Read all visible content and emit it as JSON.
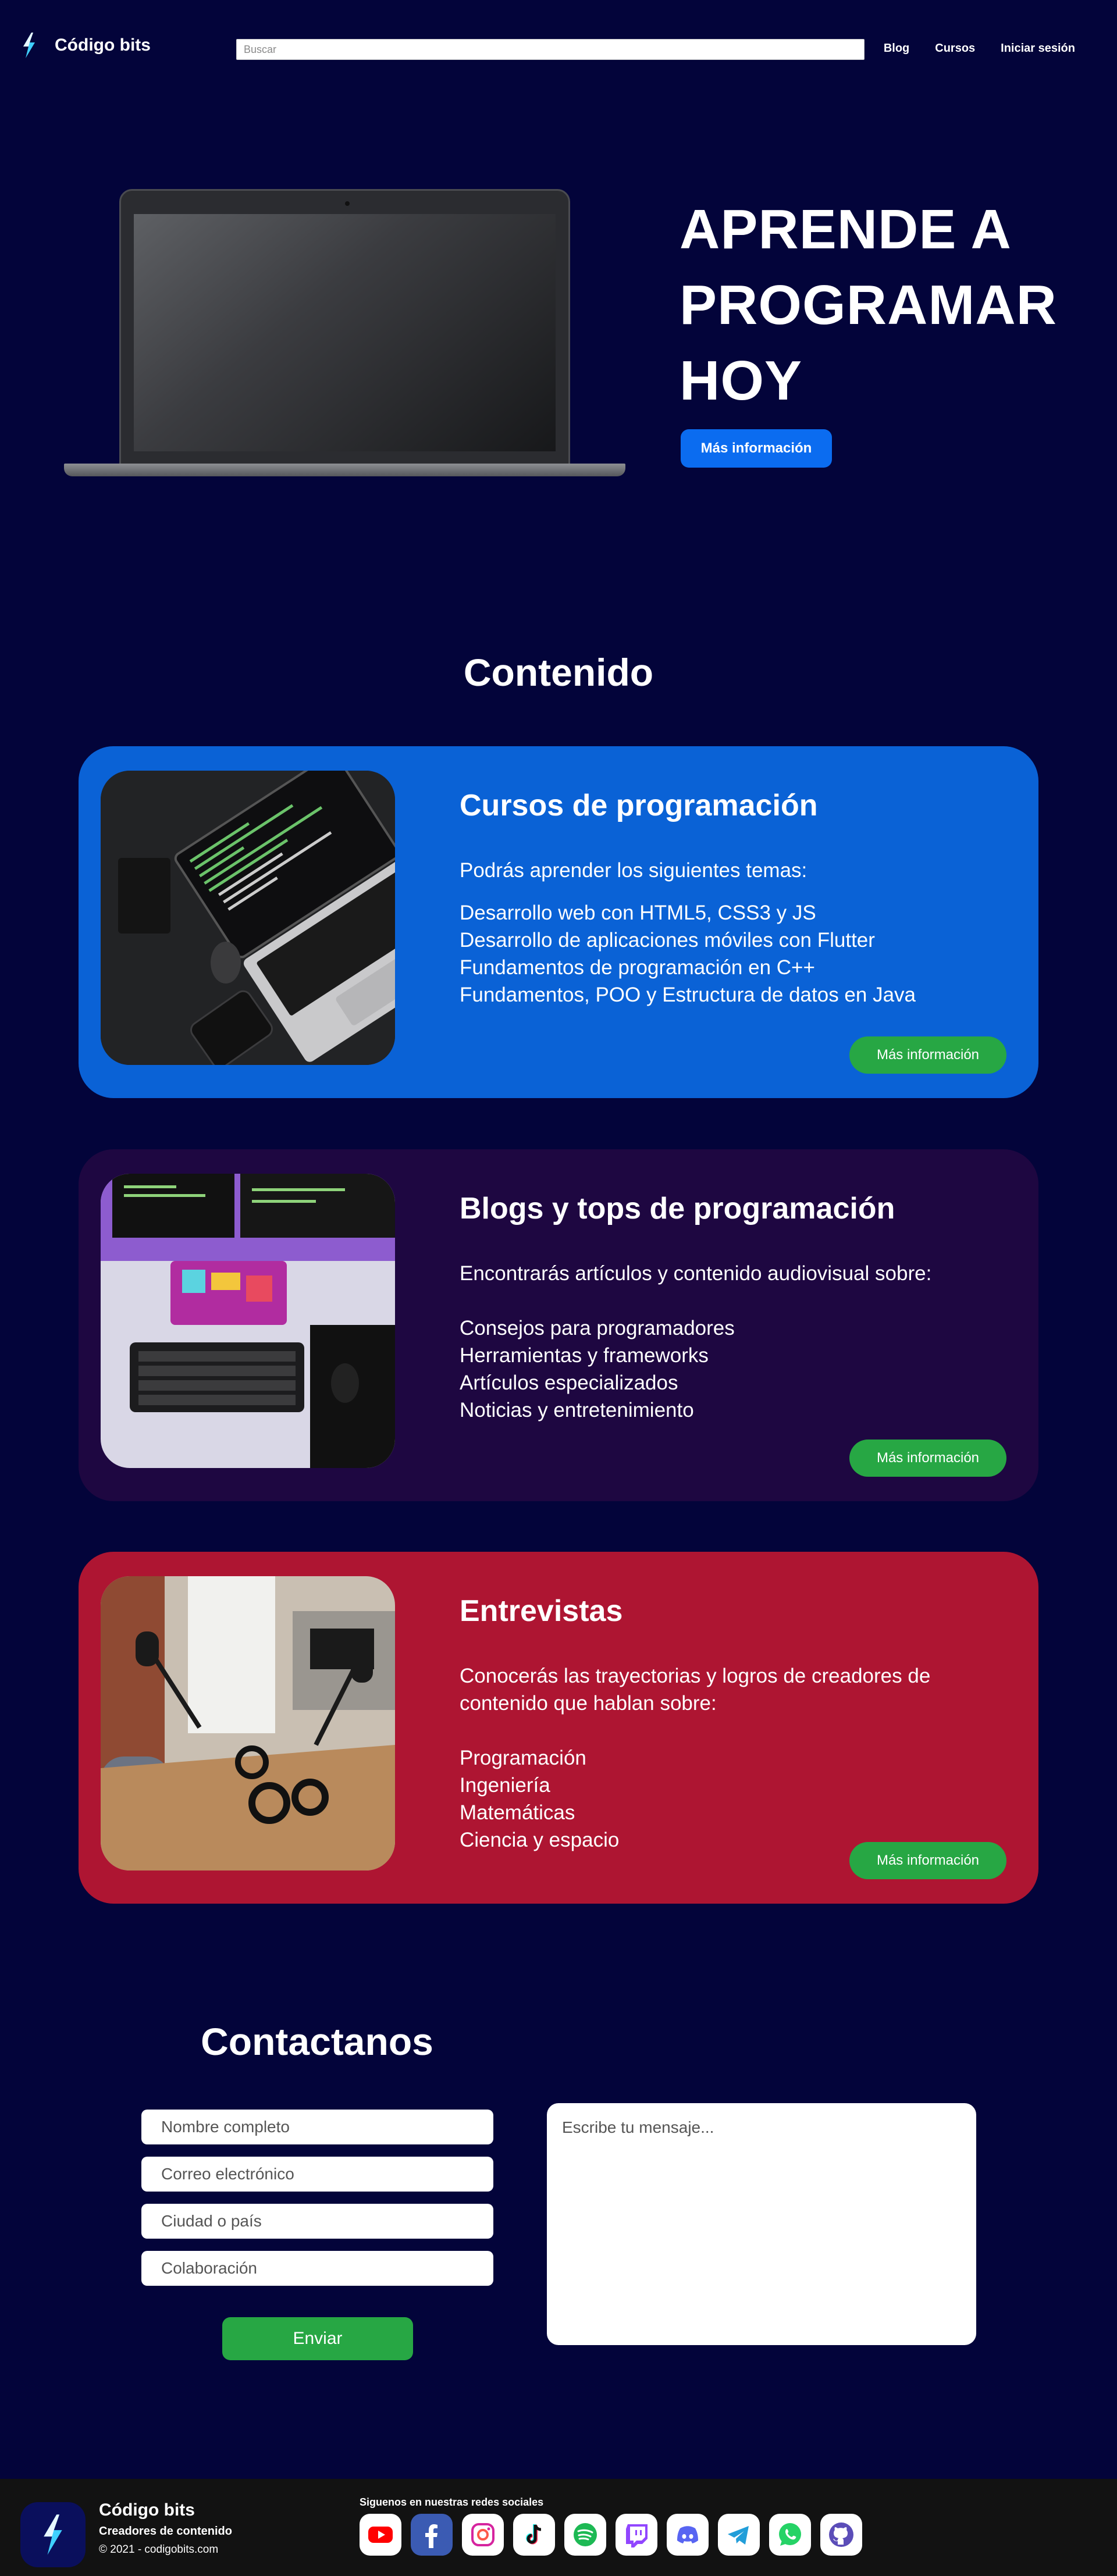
{
  "nav": {
    "brand": "Código bits",
    "search_placeholder": "Buscar",
    "links": [
      "Blog",
      "Cursos",
      "Iniciar sesión"
    ]
  },
  "hero": {
    "title": "APRENDE A PROGRAMAR HOY",
    "button": "Más información"
  },
  "content": {
    "title": "Contenido",
    "cards": [
      {
        "title": "Cursos de programación",
        "intro": "Podrás aprender los siguientes temas:",
        "items": [
          "Desarrollo web con HTML5, CSS3 y JS",
          "Desarrollo de aplicaciones móviles con Flutter",
          "Fundamentos de programación en C++",
          "Fundamentos, POO y Estructura de datos en Java"
        ],
        "button": "Más información",
        "color": "#0a62d6"
      },
      {
        "title": "Blogs y tops de programación",
        "intro": "Encontrarás artículos y contenido audiovisual sobre:",
        "items": [
          "Consejos para programadores",
          "Herramientas y frameworks",
          "Artículos especializados",
          "Noticias y entretenimiento"
        ],
        "button": "Más información",
        "color": "#1e0741"
      },
      {
        "title": "Entrevistas",
        "intro": "Conocerás las trayectorias y logros de creadores de contenido que hablan sobre:",
        "items": [
          "Programación",
          "Ingeniería",
          "Matemáticas",
          "Ciencia y espacio"
        ],
        "button": "Más información",
        "color": "#ae1532"
      }
    ]
  },
  "contact": {
    "title": "Contactanos",
    "fields": [
      "Nombre completo",
      "Correo electrónico",
      "Ciudad o país",
      "Colaboración"
    ],
    "message_placeholder": "Escribe tu mensaje...",
    "submit": "Enviar"
  },
  "footer": {
    "brand": "Código bits",
    "subtitle": "Creadores de contenido",
    "copyright": "© 2021 - codigobits.com",
    "social_label": "Siguenos en nuestras redes sociales",
    "social_icons": [
      "youtube-icon",
      "facebook-icon",
      "instagram-icon",
      "tiktok-icon",
      "spotify-icon",
      "twitch-icon",
      "discord-icon",
      "telegram-icon",
      "whatsapp-icon",
      "github-icon"
    ]
  }
}
